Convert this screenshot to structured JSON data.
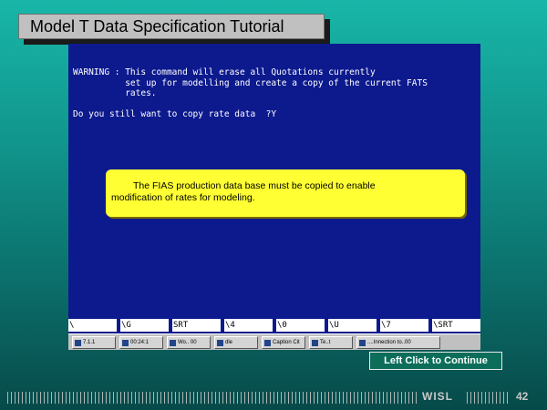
{
  "slide": {
    "title": "Model T Data Specification Tutorial",
    "footer_brand": "WISL",
    "page_number": "42"
  },
  "terminal": {
    "text": "WARNING : This command will erase all Quotations currently\n          set up for modelling and create a copy of the current FATS\n          rates.\n\nDo you still want to copy rate data  ?Y"
  },
  "callout": {
    "line1": "The FIAS production data base must be copied to enable",
    "line2": "modification of rates for modeling."
  },
  "function_keys": [
    "\\",
    "\\G",
    "SRT",
    "\\4",
    "\\0",
    "\\U",
    "\\7",
    "\\SRT"
  ],
  "taskbar": {
    "items": [
      "7.1.1",
      "00:24:1",
      "Wo.. 00",
      "dle",
      "Caption Cit",
      "Te..t",
      "....Innection to..00"
    ]
  },
  "navigation": {
    "continue_label": "Left Click to Continue"
  }
}
